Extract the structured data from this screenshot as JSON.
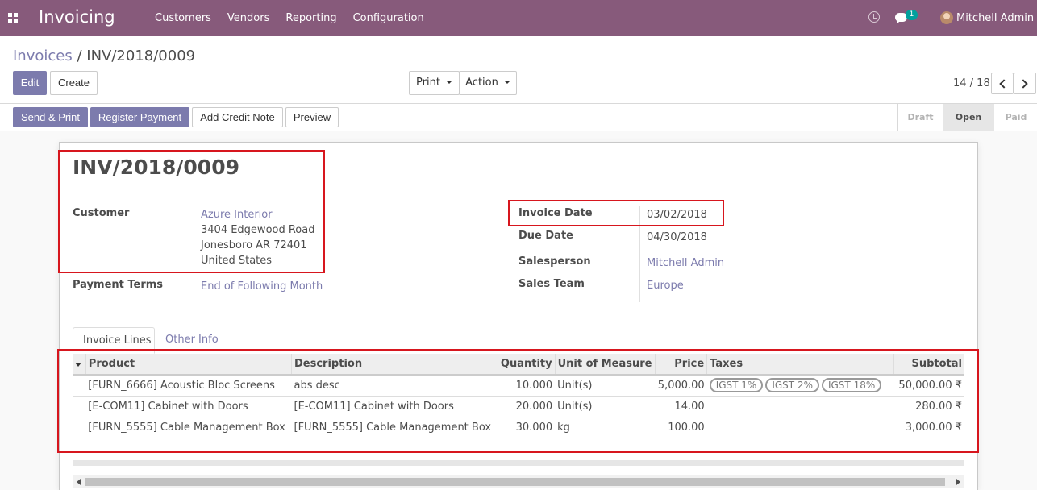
{
  "navbar": {
    "app_name": "Invoicing",
    "menu": [
      "Customers",
      "Vendors",
      "Reporting",
      "Configuration"
    ],
    "messages_count": "1",
    "user_name": "Mitchell Admin"
  },
  "breadcrumb": {
    "parent": "Invoices",
    "separator": "/",
    "current": "INV/2018/0009"
  },
  "buttons": {
    "edit": "Edit",
    "create": "Create",
    "print": "Print",
    "action": "Action"
  },
  "pager": {
    "value": "14 / 18"
  },
  "statusbar": {
    "send_print": "Send & Print",
    "register_payment": "Register Payment",
    "add_credit_note": "Add Credit Note",
    "preview": "Preview",
    "stages": [
      "Draft",
      "Open",
      "Paid"
    ],
    "active_stage": "Open"
  },
  "invoice": {
    "number": "INV/2018/0009",
    "customer_label": "Customer",
    "customer_name": "Azure Interior",
    "customer_address": [
      "3404 Edgewood Road",
      "Jonesboro AR 72401",
      "United States"
    ],
    "payment_terms_label": "Payment Terms",
    "payment_terms": "End of Following Month",
    "invoice_date_label": "Invoice Date",
    "invoice_date": "03/02/2018",
    "due_date_label": "Due Date",
    "due_date": "04/30/2018",
    "salesperson_label": "Salesperson",
    "salesperson": "Mitchell Admin",
    "sales_team_label": "Sales Team",
    "sales_team": "Europe"
  },
  "tabs": [
    "Invoice Lines",
    "Other Info"
  ],
  "lines": {
    "columns": [
      "Product",
      "Description",
      "Quantity",
      "Unit of Measure",
      "Price",
      "Taxes",
      "Subtotal"
    ],
    "rows": [
      {
        "product": "[FURN_6666] Acoustic Bloc Screens",
        "description": "abs desc",
        "quantity": "10.000",
        "uom": "Unit(s)",
        "price": "5,000.00",
        "taxes": [
          "IGST 1%",
          "IGST 2%",
          "IGST 18%"
        ],
        "subtotal": "50,000.00 ₹"
      },
      {
        "product": "[E-COM11] Cabinet with Doors",
        "description": "[E-COM11] Cabinet with Doors",
        "quantity": "20.000",
        "uom": "Unit(s)",
        "price": "14.00",
        "taxes": [],
        "subtotal": "280.00 ₹"
      },
      {
        "product": "[FURN_5555] Cable Management Box",
        "description": "[FURN_5555] Cable Management Box",
        "quantity": "30.000",
        "uom": "kg",
        "price": "100.00",
        "taxes": [],
        "subtotal": "3,000.00 ₹"
      }
    ]
  },
  "colors": {
    "brand": "#875a7b",
    "primary": "#7c7bad",
    "highlight": "#d7161e"
  }
}
